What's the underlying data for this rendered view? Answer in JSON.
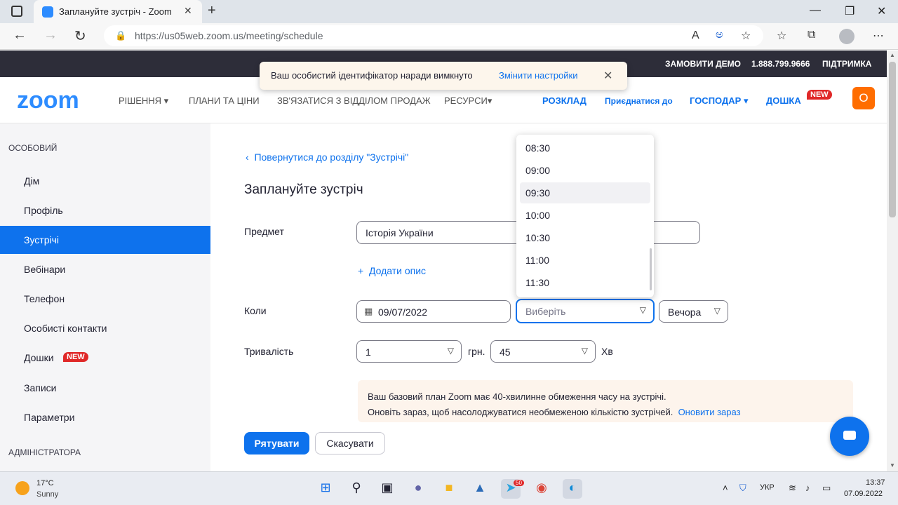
{
  "browser": {
    "tab_title": "Заплануйте зустріч - Zoom",
    "tab_close": "✕",
    "new_tab": "+",
    "url": "https://us05web.zoom.us/meeting/schedule",
    "read_aloud": "A̧",
    "translate": "ಅ"
  },
  "topbar": {
    "demo": "ЗАМОВИТИ ДЕМО",
    "phone": "1.888.799.9666",
    "support": "ПІДТРИМКА"
  },
  "notice": {
    "text": "Ваш особистий ідентифікатор наради вимкнуто",
    "link": "Змінити настройки",
    "close": "✕"
  },
  "nav": {
    "logo": "zoom",
    "solutions": "РІШЕННЯ",
    "plans": "ПЛАНИ ТА ЦІНИ",
    "contact_sales": "ЗВ'ЯЗАТИСЯ З ВІДДІЛОМ ПРОДАЖ",
    "resources": "РЕСУРСИ",
    "schedule": "РОЗКЛАД",
    "join": "Приєднатися до",
    "host": "ГОСПОДАР",
    "whiteboard": "ДОШКА",
    "new_badge": "NEW",
    "avatar_letter": "О"
  },
  "sidebar": {
    "personal_section": "ОСОБОВИЙ",
    "items": [
      {
        "label": "Дім"
      },
      {
        "label": "Профіль"
      },
      {
        "label": "Зустрічі"
      },
      {
        "label": "Вебінари"
      },
      {
        "label": "Телефон"
      },
      {
        "label": "Особисті контакти"
      },
      {
        "label": "Дошки"
      },
      {
        "label": "Записи"
      },
      {
        "label": "Параметри"
      }
    ],
    "new_badge": "NEW",
    "admin_section": "АДМІНІСТРАТОРА"
  },
  "main": {
    "back_link": "Повернутися до розділу \"Зустрічі\"",
    "title": "Заплануйте зустріч",
    "topic_label": "Предмет",
    "topic_value": "Історія України",
    "add_description": "Додати опис",
    "when_label": "Коли",
    "date_value": "09/07/2022",
    "time_placeholder": "Виберіть",
    "ampm_value": "Вечора",
    "duration_label": "Тривалість",
    "duration_hours": "1",
    "hours_unit": "грн.",
    "duration_minutes": "45",
    "minutes_unit": "Хв",
    "banner_line1": "Ваш базовий план Zoom має 40-хвилинне обмеження часу на зустрічі.",
    "banner_line2": "Оновіть зараз, щоб насолоджуватися необмеженою кількістю зустрічей.",
    "banner_link": "Оновити зараз",
    "save": "Рятувати",
    "cancel": "Скасувати"
  },
  "time_dropdown": {
    "options": [
      "08:30",
      "09:00",
      "09:30",
      "10:00",
      "10:30",
      "11:00",
      "11:30"
    ],
    "hovered": "09:30"
  },
  "taskbar": {
    "temp": "17°C",
    "weather": "Sunny",
    "telegram_badge": "50",
    "lang": "УКР",
    "time": "13:37",
    "date": "07.09.2022"
  }
}
